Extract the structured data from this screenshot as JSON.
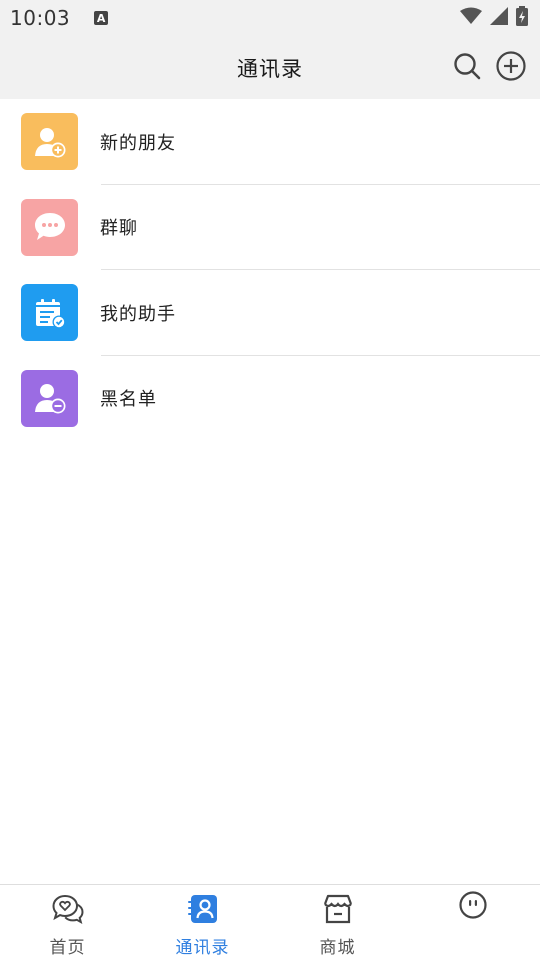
{
  "status_bar": {
    "time": "10:03",
    "notification_badge": "A"
  },
  "header": {
    "title": "通讯录",
    "search_icon": "search-icon",
    "add_icon": "plus-circle-icon"
  },
  "list": {
    "items": [
      {
        "label": "新的朋友",
        "icon": "add-friend-icon",
        "color": "#f9bd5d"
      },
      {
        "label": "群聊",
        "icon": "chat-bubble-icon",
        "color": "#f7a4a4"
      },
      {
        "label": "我的助手",
        "icon": "calendar-check-icon",
        "color": "#1f9cf0"
      },
      {
        "label": "黑名单",
        "icon": "remove-user-icon",
        "color": "#9b6ce3"
      }
    ]
  },
  "tabbar": {
    "tabs": [
      {
        "label": "首页",
        "icon": "chat-heart-icon"
      },
      {
        "label": "通讯录",
        "icon": "contacts-icon",
        "active": true
      },
      {
        "label": "商城",
        "icon": "store-icon"
      },
      {
        "label": "",
        "icon": "face-icon"
      }
    ],
    "active_color": "#2f7fe0"
  }
}
